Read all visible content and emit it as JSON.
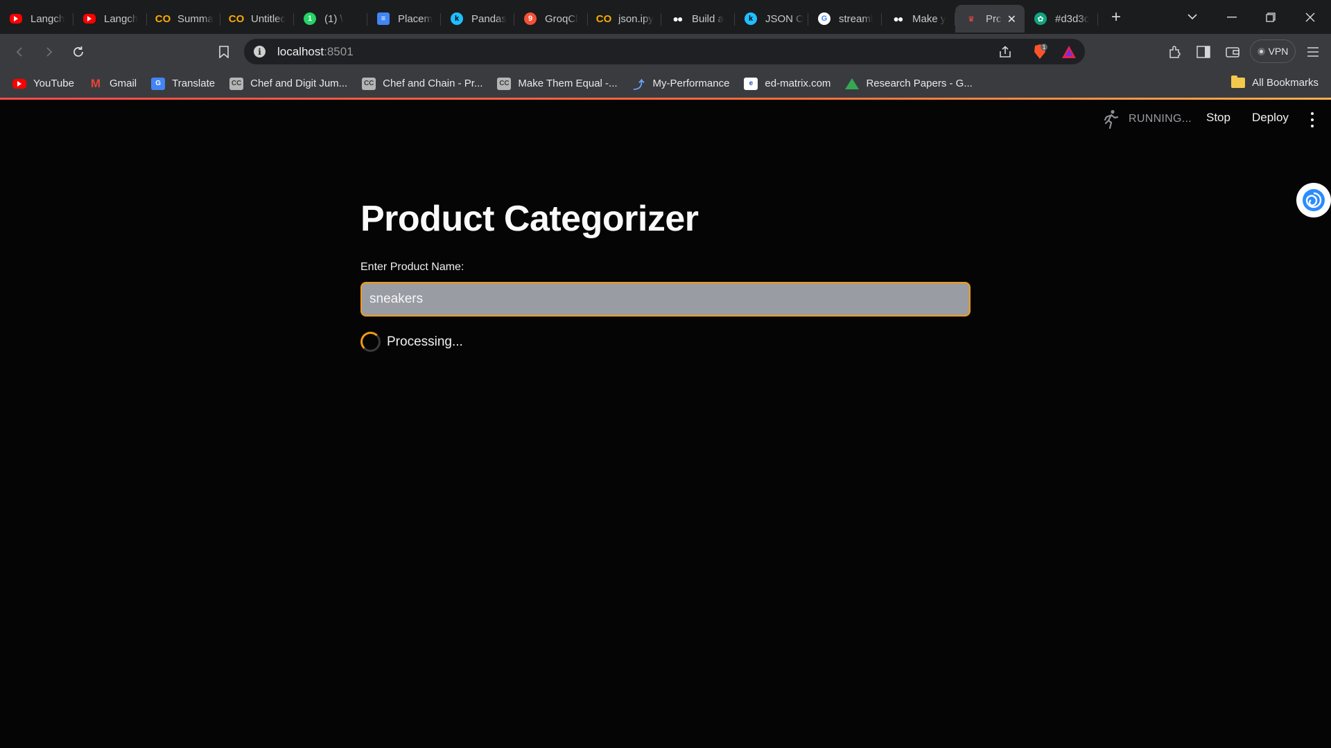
{
  "browser": {
    "tabs": [
      {
        "title": "Langch",
        "icon": "youtube-icon"
      },
      {
        "title": "Langch",
        "icon": "youtube-icon"
      },
      {
        "title": "Summa",
        "icon": "colab-icon"
      },
      {
        "title": "Untitlec",
        "icon": "colab-icon"
      },
      {
        "title": "(1) \\",
        "icon": "whatsapp-icon",
        "badge": "1"
      },
      {
        "title": "Placem",
        "icon": "google-docs-icon"
      },
      {
        "title": "Pandas",
        "icon": "kaggle-icon"
      },
      {
        "title": "GroqCl",
        "icon": "groq-icon",
        "badge": "9"
      },
      {
        "title": "json.ipy",
        "icon": "colab-icon"
      },
      {
        "title": "Build a",
        "icon": "medium-icon"
      },
      {
        "title": "JSON C",
        "icon": "kaggle-icon"
      },
      {
        "title": "streaml",
        "icon": "google-icon"
      },
      {
        "title": "Make y",
        "icon": "medium-icon"
      },
      {
        "title": "Prc",
        "icon": "streamlit-icon",
        "active": true
      },
      {
        "title": "#d3d3c",
        "icon": "chatgpt-icon"
      }
    ],
    "address": {
      "host": "localhost",
      "port": ":8501"
    },
    "vpn_label": "VPN",
    "brave_badge": "1",
    "bookmarks": [
      {
        "label": "YouTube",
        "icon": "youtube-icon"
      },
      {
        "label": "Gmail",
        "icon": "gmail-icon"
      },
      {
        "label": "Translate",
        "icon": "translate-icon"
      },
      {
        "label": "Chef and Digit Jum...",
        "icon": "codechef-icon"
      },
      {
        "label": "Chef and Chain - Pr...",
        "icon": "codechef-icon"
      },
      {
        "label": "Make Them Equal -...",
        "icon": "codechef-icon"
      },
      {
        "label": "My-Performance",
        "icon": "performance-icon"
      },
      {
        "label": "ed-matrix.com",
        "icon": "ed-matrix-icon"
      },
      {
        "label": "Research Papers - G...",
        "icon": "google-drive-icon"
      }
    ],
    "all_bookmarks_label": "All Bookmarks"
  },
  "app": {
    "status": "RUNNING...",
    "stop_label": "Stop",
    "deploy_label": "Deploy",
    "title": "Product Categorizer",
    "input_label": "Enter Product Name:",
    "input_value": "sneakers",
    "spinner_text": "Processing..."
  },
  "colors": {
    "accent": "#f39c12",
    "background": "#050505",
    "input_fill": "#9a9ca4",
    "streamlit_red": "#ff4b4b"
  }
}
